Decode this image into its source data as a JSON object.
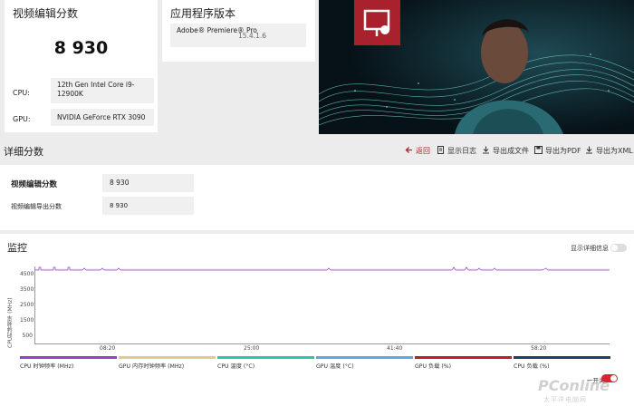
{
  "score_card": {
    "title": "视频编辑分数",
    "score": "8 930",
    "cpu_label": "CPU:",
    "cpu_value": "12th Gen Intel Core i9-12900K",
    "gpu_label": "GPU:",
    "gpu_value": "NVIDIA GeForce RTX 3090"
  },
  "app_card": {
    "title": "应用程序版本",
    "app_name": "Adobe® Premiere® Pro",
    "app_version": "15.4.1.6"
  },
  "detail": {
    "title": "详细分数",
    "toolbar": [
      {
        "label": "返回",
        "icon": "back-arrow-icon"
      },
      {
        "label": "显示日志",
        "icon": "document-icon"
      },
      {
        "label": "导出成文件",
        "icon": "download-icon"
      },
      {
        "label": "导出为PDF",
        "icon": "save-icon"
      },
      {
        "label": "导出为XML",
        "icon": "download-icon"
      }
    ],
    "rows": [
      {
        "label": "视频编辑分数",
        "value": "8 930"
      },
      {
        "label": "视频编辑导出分数",
        "value": "8 930"
      }
    ]
  },
  "monitor": {
    "title": "监控",
    "show_details_label": "显示详细信息",
    "ylabel": "CPU时钟频率 (MHz)",
    "yticks": [
      "4500",
      "3500",
      "2500",
      "1500",
      "500"
    ],
    "xticks": [
      "08:20",
      "25:00",
      "41:40",
      "58:20"
    ],
    "legend": [
      {
        "label": "CPU 时钟频率 (MHz)",
        "color": "#8e44c9"
      },
      {
        "label": "GPU 内存时钟频率 (MHz)",
        "color": "#e3c98a"
      },
      {
        "label": "CPU 温度 (°C)",
        "color": "#2ec4a6"
      },
      {
        "label": "GPU 温度 (°C)",
        "color": "#5aa9e6"
      },
      {
        "label": "GPU 负载 (%)",
        "color": "#b8202c"
      },
      {
        "label": "CPU 负载 (%)",
        "color": "#1f3f66"
      }
    ],
    "legend_switch_label": "一开关",
    "watermark": "PConline",
    "watermark_sub": "太平洋电脑网"
  },
  "colors": {
    "accent_red": "#a8212c",
    "back_red": "#b8202c",
    "line_purple": "#8e44c9"
  }
}
